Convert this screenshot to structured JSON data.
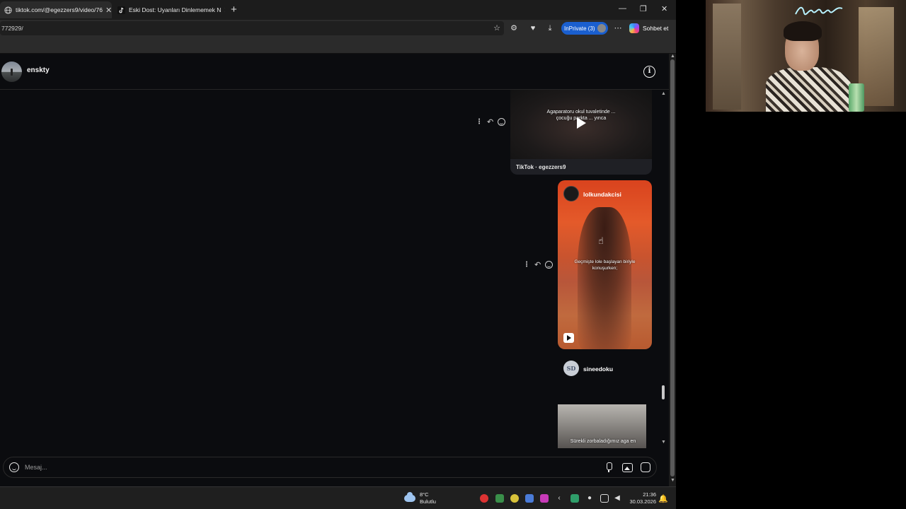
{
  "browser": {
    "tabs": [
      {
        "label": "tiktok.com/@egezzers9/video/76"
      },
      {
        "label": "Eski Dost: Uyanları Dinlememek N"
      }
    ],
    "url": "772929/",
    "inprivate_label": "InPrivate (3)",
    "chat_label": "Sohbet et"
  },
  "dm": {
    "username": "enskty",
    "messages": [
      {
        "type": "tiktok-share",
        "caption": "Agaparatoru okul tuvaletinde ... çocuğu parkta ... yınca",
        "source": "TikTok · egezzers9"
      },
      {
        "type": "reel-share",
        "username": "lolkundakcisi",
        "caption": "Geçmişte lole başlayan biriyle konuşurken;"
      },
      {
        "type": "post-share",
        "username": "sineedoku",
        "avatar_text": "SD",
        "caption": "Sürekli zorbaladığımız aga en"
      }
    ],
    "composer_placeholder": "Mesaj..."
  },
  "taskbar": {
    "temperature": "8°C",
    "weather": "Bulutlu",
    "time": "21:36",
    "date": "30.03.2026"
  },
  "colors": {
    "accent_inprivate": "#1a5fcf",
    "page_bg": "#0b0c0f",
    "reel_bg": "#d9431e"
  }
}
